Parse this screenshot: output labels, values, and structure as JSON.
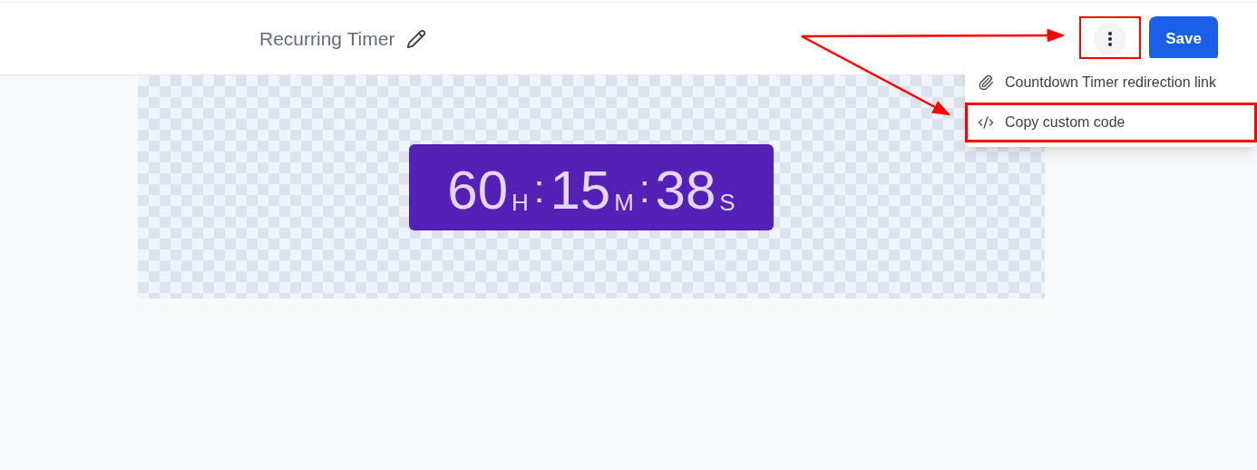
{
  "header": {
    "title": "Recurring Timer",
    "save_button": "Save"
  },
  "menu": {
    "items": [
      {
        "kind": "link",
        "label": "Countdown Timer redirection link"
      },
      {
        "kind": "code",
        "label": "Copy custom code"
      }
    ]
  },
  "timer": {
    "parts": [
      {
        "value": "60",
        "unit": "H"
      },
      {
        "value": "15",
        "unit": "M"
      },
      {
        "value": "38",
        "unit": "S"
      }
    ],
    "separator": ":"
  }
}
